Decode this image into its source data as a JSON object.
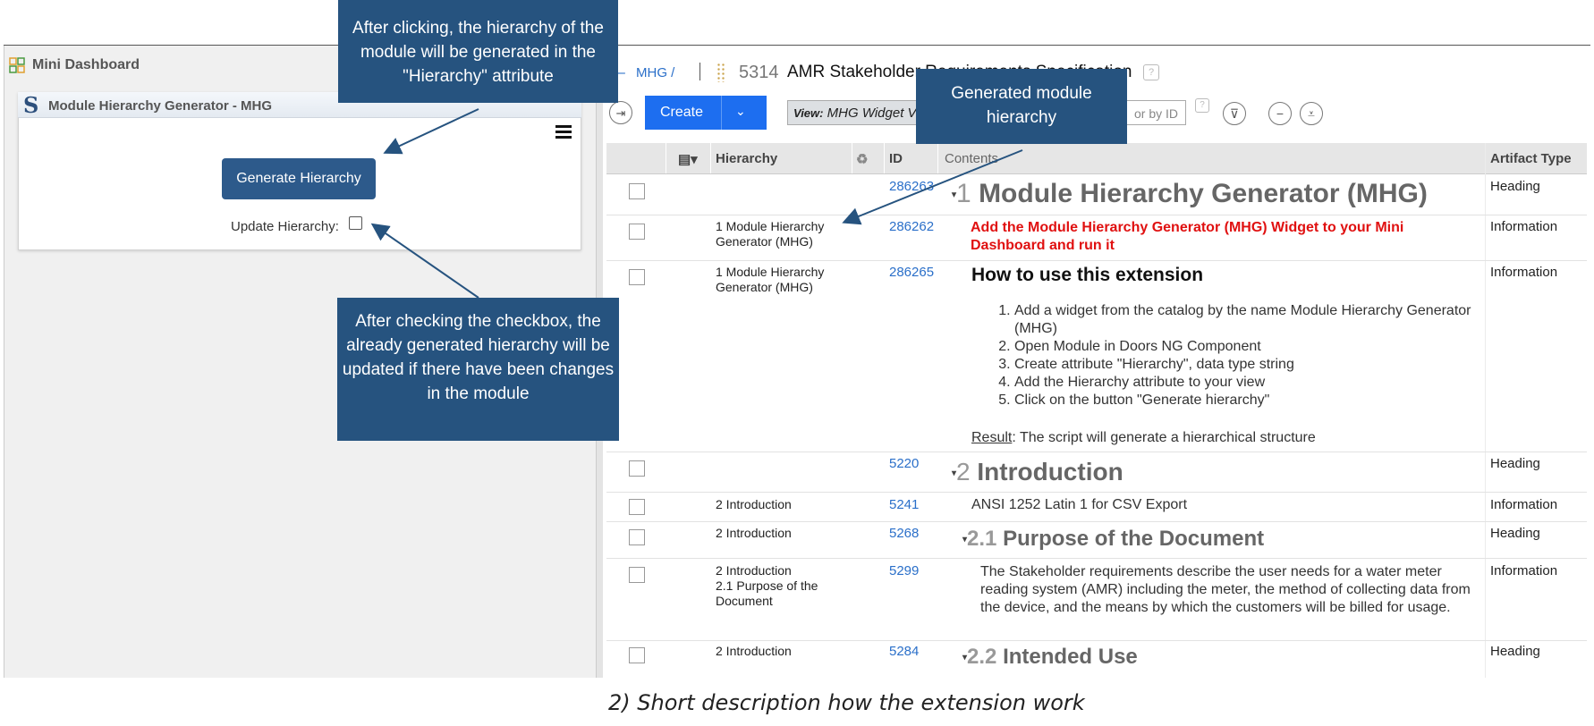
{
  "callouts": {
    "generate": "After clicking, the hierarchy of the module will be generated in the \"Hierarchy\" attribute",
    "update": "After checking the checkbox, the already generated hierarchy will be updated if there have been changes in the module",
    "generated": "Generated module hierarchy"
  },
  "mini_dashboard": {
    "title": "Mini Dashboard",
    "widget_title": "Module Hierarchy Generator - MHG",
    "generate_button": "Generate Hierarchy",
    "update_label": "Update Hierarchy:"
  },
  "module": {
    "breadcrumb": "MHG /",
    "id": "5314",
    "title": "AMR Stakeholder Requirements Specification",
    "create_button": "Create",
    "view_label": "View:",
    "view_value": "MHG Widget View",
    "filter_placeholder": "or by ID"
  },
  "columns": {
    "hierarchy": "Hierarchy",
    "id": "ID",
    "contents": "Contents",
    "artifact_type": "Artifact Type"
  },
  "rows": [
    {
      "hierarchy": "",
      "id": "286263",
      "num": "1",
      "heading": "Module Hierarchy Generator (MHG)",
      "type": "Heading"
    },
    {
      "hierarchy": "1 Module Hierarchy Generator (MHG)",
      "id": "286262",
      "text": "Add the Module Hierarchy Generator (MHG) Widget to your Mini Dashboard and run it",
      "type": "Information"
    },
    {
      "hierarchy": "1 Module Hierarchy Generator (MHG)",
      "id": "286265",
      "heading": "How to use this extension",
      "type": "Information",
      "steps": [
        "Add a widget from the catalog by the name Module Hierarchy Generator (MHG)",
        "Open Module in Doors NG Component",
        "Create attribute \"Hierarchy\", data type string",
        "Add the Hierarchy attribute to your view",
        "Click on the button \"Generate hierarchy\""
      ],
      "result_label": "Result",
      "result_text": ": The script will generate a hierarchical structure"
    },
    {
      "hierarchy": "",
      "id": "5220",
      "num": "2",
      "heading": "Introduction",
      "type": "Heading"
    },
    {
      "hierarchy": "2 Introduction",
      "id": "5241",
      "text": "ANSI 1252 Latin 1 for CSV Export",
      "type": "Information"
    },
    {
      "hierarchy": "2 Introduction",
      "id": "5268",
      "num": "2.1",
      "heading": "Purpose of the Document",
      "type": "Heading"
    },
    {
      "hierarchy": "2 Introduction\n2.1 Purpose of the Document",
      "id": "5299",
      "text": "The Stakeholder requirements describe the user needs for a water meter reading system (AMR) including the meter, the method of collecting data from the device, and the means by which the customers will be billed for usage.",
      "type": "Information"
    },
    {
      "hierarchy": "2 Introduction",
      "id": "5284",
      "num": "2.2",
      "heading": "Intended Use",
      "type": "Heading"
    }
  ],
  "caption": "2) Short description how the extension work"
}
